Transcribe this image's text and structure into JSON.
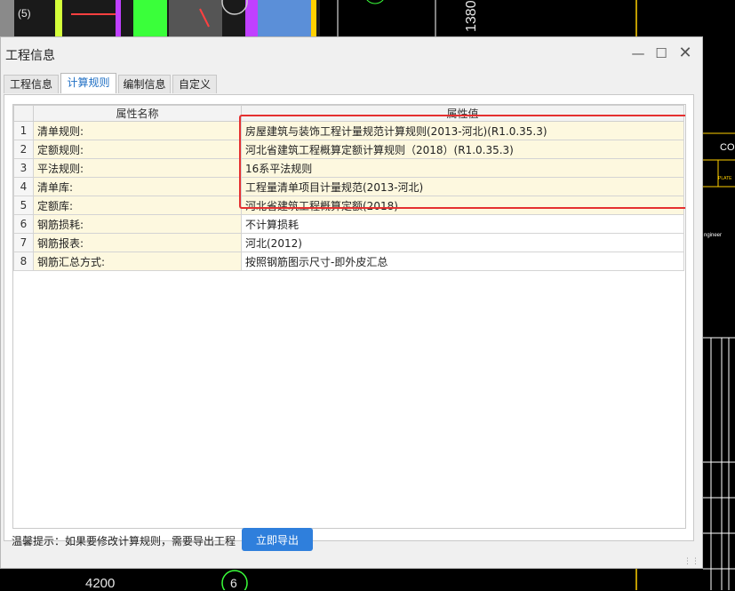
{
  "background": {
    "labels": [
      "(5)",
      "1380",
      "4200",
      "6",
      "COU",
      "PLATE",
      "ngineer"
    ]
  },
  "dialog": {
    "title": "工程信息",
    "minimize_icon": "minimize-icon",
    "maximize_icon": "maximize-icon",
    "close_icon": "close-icon",
    "tabs": [
      {
        "label": "工程信息",
        "active": false
      },
      {
        "label": "计算规则",
        "active": true
      },
      {
        "label": "编制信息",
        "active": false
      },
      {
        "label": "自定义",
        "active": false
      }
    ],
    "table": {
      "headers": [
        "属性名称",
        "属性值"
      ],
      "rows": [
        {
          "index": "1",
          "name": "清单规则:",
          "value": "房屋建筑与装饰工程计量规范计算规则(2013-河北)(R1.0.35.3)",
          "highlighted": true
        },
        {
          "index": "2",
          "name": "定额规则:",
          "value": "河北省建筑工程概算定额计算规则（2018）(R1.0.35.3)",
          "highlighted": true
        },
        {
          "index": "3",
          "name": "平法规则:",
          "value": "16系平法规则",
          "highlighted": true
        },
        {
          "index": "4",
          "name": "清单库:",
          "value": "工程量清单项目计量规范(2013-河北)",
          "highlighted": true
        },
        {
          "index": "5",
          "name": "定额库:",
          "value": "河北省建筑工程概算定额(2018)",
          "highlighted": true
        },
        {
          "index": "6",
          "name": "钢筋损耗:",
          "value": "不计算损耗",
          "highlighted": false
        },
        {
          "index": "7",
          "name": "钢筋报表:",
          "value": "河北(2012)",
          "highlighted": false
        },
        {
          "index": "8",
          "name": "钢筋汇总方式:",
          "value": "按照钢筋图示尺寸-即外皮汇总",
          "highlighted": false
        }
      ]
    },
    "hint": "温馨提示：如果要修改计算规则，需要导出工程",
    "export_button": "立即导出",
    "colors": {
      "accent": "#2f7fdc",
      "highlight_border": "#e53030",
      "row_fill": "#fdf8df"
    }
  }
}
